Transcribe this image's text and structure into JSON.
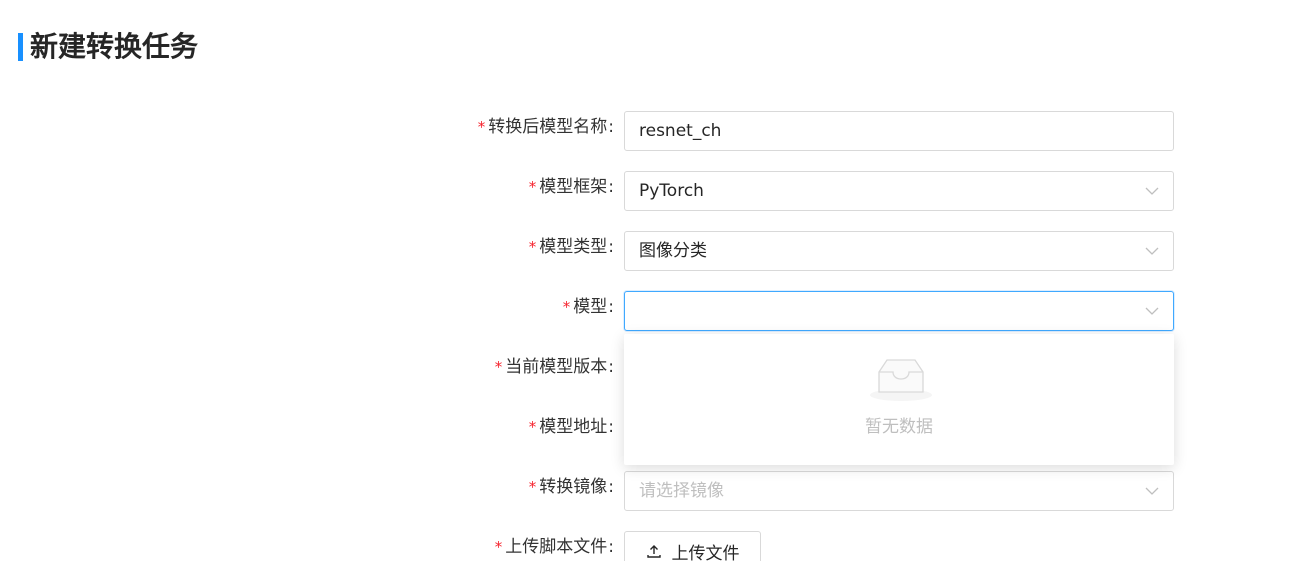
{
  "page": {
    "title": "新建转换任务"
  },
  "form": {
    "required_mark": "*",
    "colon": ":",
    "converted_model_name": {
      "label": "转换后模型名称",
      "value": "resnet_ch"
    },
    "model_framework": {
      "label": "模型框架",
      "value": "PyTorch"
    },
    "model_type": {
      "label": "模型类型",
      "value": "图像分类"
    },
    "model": {
      "label": "模型",
      "value": ""
    },
    "current_model_version": {
      "label": "当前模型版本"
    },
    "model_address": {
      "label": "模型地址"
    },
    "conversion_image": {
      "label": "转换镜像",
      "placeholder": "请选择镜像"
    },
    "upload_script": {
      "label": "上传脚本文件",
      "button_label": "上传文件"
    }
  },
  "dropdown": {
    "empty_text": "暂无数据"
  },
  "colors": {
    "accent": "#1890ff",
    "required": "#f5222d",
    "border": "#d9d9d9",
    "focus_border": "#40a9ff",
    "placeholder": "#bfbfbf"
  },
  "icons": {
    "chevron": "chevron-down-icon",
    "empty": "empty-inbox-icon",
    "upload": "upload-icon"
  }
}
